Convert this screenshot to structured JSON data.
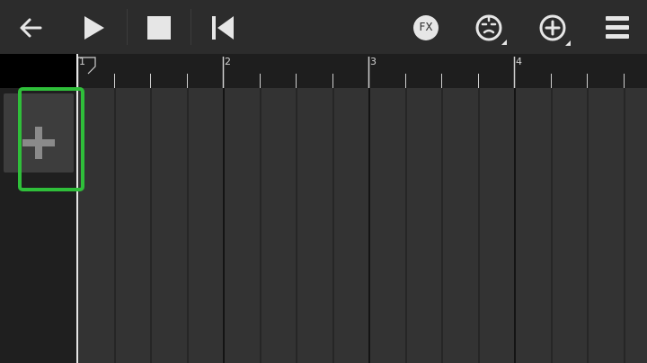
{
  "toolbar": {
    "back": {
      "icon": "arrow-left-icon"
    },
    "play": {
      "icon": "play-icon"
    },
    "stop": {
      "icon": "stop-icon"
    },
    "rewind": {
      "icon": "skip-to-start-icon"
    },
    "fx": {
      "icon": "fx-icon",
      "label": "FX"
    },
    "tempo": {
      "icon": "metronome-face-icon"
    },
    "add": {
      "icon": "add-circle-icon"
    },
    "menu": {
      "icon": "menu-icon"
    }
  },
  "ruler": {
    "bar_labels": [
      "1",
      "2",
      "3",
      "4"
    ]
  },
  "track_panel": {
    "add_track": {
      "icon": "plus-icon"
    }
  },
  "colors": {
    "highlight": "#2fbf3a",
    "playhead": "#e6e6e6",
    "grid_background": "#333333"
  }
}
